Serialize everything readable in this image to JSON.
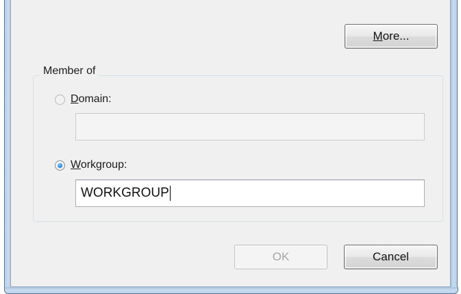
{
  "buttons": {
    "more": {
      "prefix": "",
      "accel": "M",
      "rest": "ore..."
    },
    "ok": "OK",
    "cancel": "Cancel"
  },
  "member_of": {
    "title": "Member of",
    "domain": {
      "accel": "D",
      "rest": "omain:",
      "value": "",
      "enabled": false,
      "selected": false
    },
    "workgroup": {
      "accel": "W",
      "rest": "orkgroup:",
      "value": "WORKGROUP",
      "enabled": true,
      "selected": true
    }
  },
  "colors": {
    "dialog_bg": "#f0f0f0",
    "frame_blue": "#b9d1ea",
    "radio_selected": "#2c8be2"
  }
}
